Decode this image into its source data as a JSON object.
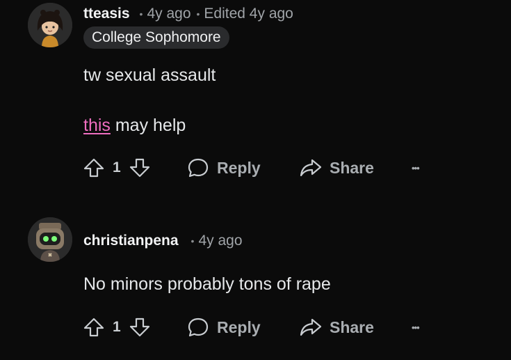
{
  "comments": [
    {
      "author": "tteasis",
      "separator": "•",
      "time": "4y ago",
      "edited": "Edited 4y ago",
      "flair": "College Sophomore",
      "lines": [
        "tw sexual assault"
      ],
      "link_text": "this",
      "link_rest": " may help",
      "score": "1",
      "reply_label": "Reply",
      "share_label": "Share",
      "more_label": "•••"
    },
    {
      "author": "christianpena",
      "separator": "•",
      "time": "4y ago",
      "body": "No minors probably tons of rape",
      "score": "1",
      "reply_label": "Reply",
      "share_label": "Share",
      "more_label": "•••"
    }
  ]
}
